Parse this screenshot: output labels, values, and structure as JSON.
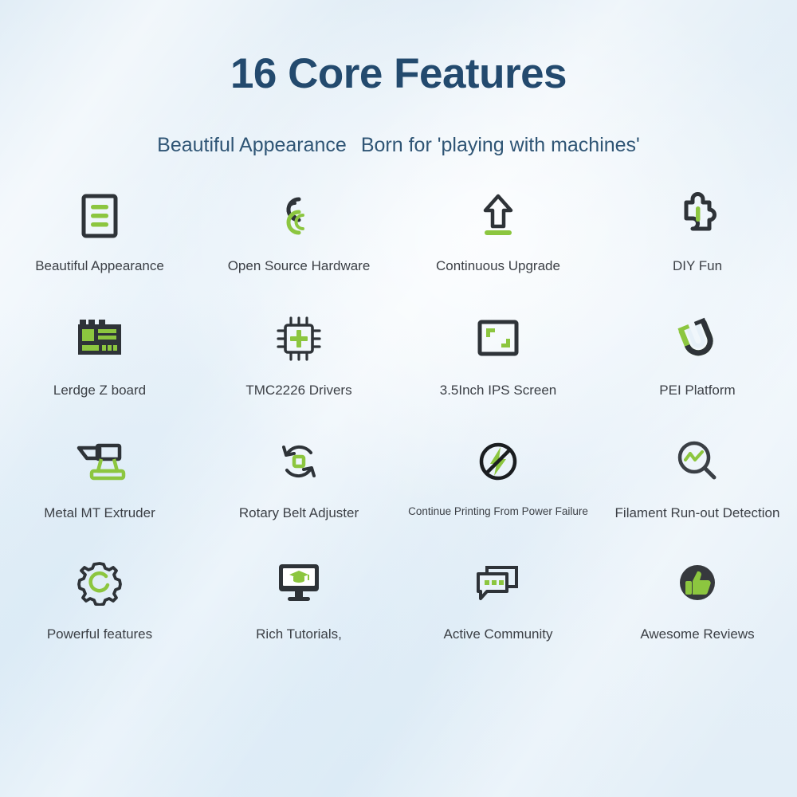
{
  "header": {
    "title": "16 Core Features",
    "subtitle_left": "Beautiful Appearance",
    "subtitle_right": "Born for 'playing with machines'"
  },
  "colors": {
    "title": "#234a6e",
    "subtitle": "#2f5575",
    "label": "#3b3f45",
    "accent_green": "#8cc63f",
    "icon_dark": "#2e3338",
    "background": "#e3eef7"
  },
  "features": [
    {
      "label": "Beautiful Appearance",
      "icon": "document-lines-icon"
    },
    {
      "label": "Open Source Hardware",
      "icon": "open-source-rings-icon"
    },
    {
      "label": "Continuous Upgrade",
      "icon": "upload-arrow-icon"
    },
    {
      "label": "DIY Fun",
      "icon": "puzzle-piece-icon"
    },
    {
      "label": "Lerdge Z board",
      "icon": "circuit-board-icon"
    },
    {
      "label": "TMC2226 Drivers",
      "icon": "chip-icon"
    },
    {
      "label": "3.5Inch IPS Screen",
      "icon": "screen-frame-icon"
    },
    {
      "label": "PEI Platform",
      "icon": "magnet-icon"
    },
    {
      "label": "Metal MT Extruder",
      "icon": "anvil-icon"
    },
    {
      "label": "Rotary Belt Adjuster",
      "icon": "rotate-arrows-icon"
    },
    {
      "label": "Continue Printing From Power Failure",
      "icon": "power-failure-icon"
    },
    {
      "label": "Filament Run-out Detection",
      "icon": "magnifier-wave-icon"
    },
    {
      "label": "Powerful features",
      "icon": "gear-icon"
    },
    {
      "label": "Rich Tutorials,",
      "icon": "monitor-graduation-icon"
    },
    {
      "label": "Active Community",
      "icon": "chat-bubbles-icon"
    },
    {
      "label": "Awesome Reviews",
      "icon": "thumbs-up-icon"
    }
  ]
}
